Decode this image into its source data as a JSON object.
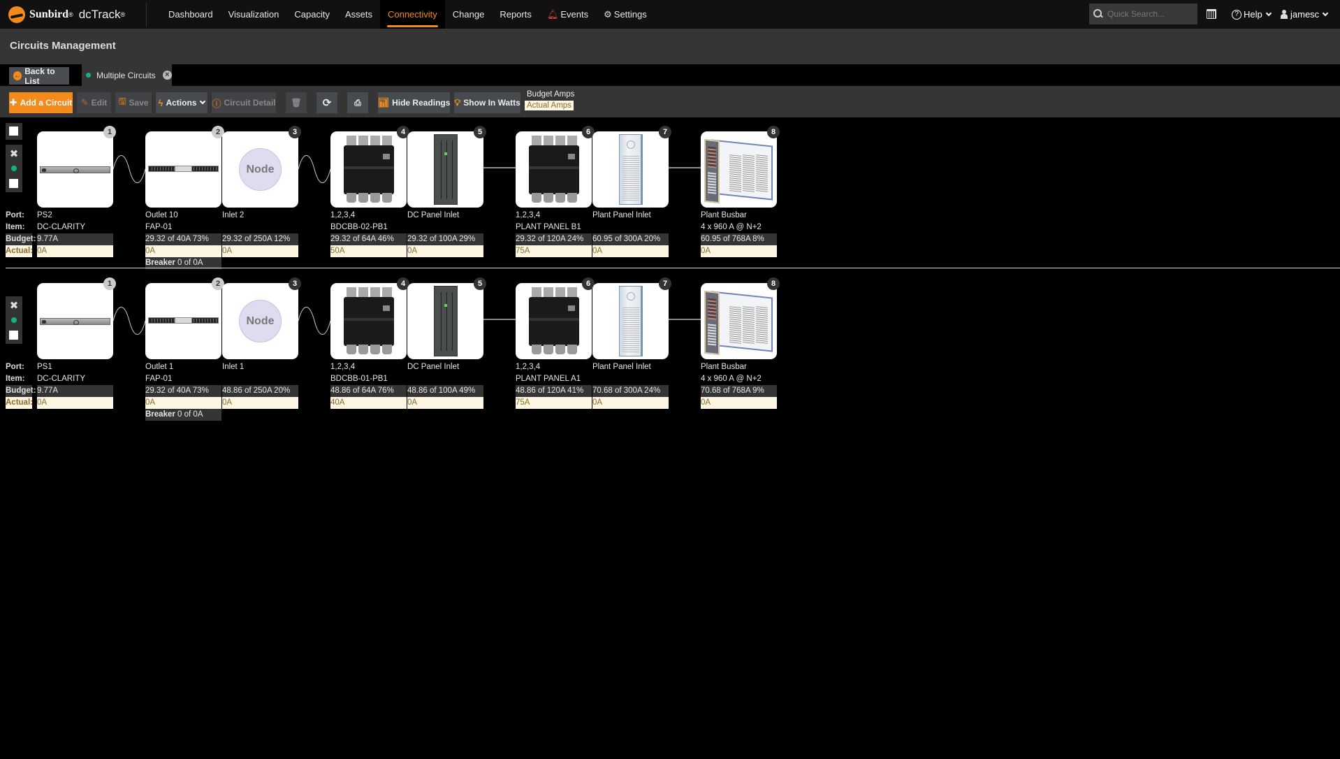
{
  "app": {
    "brand": "Sunbird",
    "product": "dcTrack",
    "registered_mark": "®"
  },
  "nav": {
    "items": [
      {
        "label": "Dashboard",
        "active": false
      },
      {
        "label": "Visualization",
        "active": false
      },
      {
        "label": "Capacity",
        "active": false
      },
      {
        "label": "Assets",
        "active": false
      },
      {
        "label": "Connectivity",
        "active": true
      },
      {
        "label": "Change",
        "active": false
      },
      {
        "label": "Reports",
        "active": false
      },
      {
        "label": "Events",
        "active": false,
        "icon": "bell-icon"
      },
      {
        "label": "Settings",
        "active": false,
        "icon": "gear-icon"
      }
    ],
    "search_placeholder": "Quick Search...",
    "help_label": "Help",
    "user_label": "jamesc"
  },
  "page": {
    "title": "Circuits Management"
  },
  "tabs": {
    "back_label": "Back to List",
    "active_tab_label": "Multiple Circuits"
  },
  "toolbar": {
    "add_circuit": "Add a Circuit",
    "edit": "Edit",
    "save": "Save",
    "actions": "Actions",
    "circuit_detail": "Circuit Detail",
    "hide_readings": "Hide Readings",
    "show_in_watts": "Show In Watts",
    "legend_budget": "Budget Amps",
    "legend_actual": "Actual Amps"
  },
  "row_labels": {
    "port": "Port:",
    "item": "Item:",
    "budget": "Budget:",
    "actual": "Actual:"
  },
  "colors": {
    "accent": "#f28b1c",
    "status_green": "#16b088",
    "actual_bg": "#fdf6e3",
    "actual_text": "#8a6a2a",
    "budget_bg": "#353535"
  },
  "circuits": [
    {
      "has_select_all": true,
      "nodes": [
        {
          "num": "1",
          "type": "server",
          "port": "PS2",
          "item": "DC-CLARITY",
          "budget": "9.77A",
          "actual": "0A"
        },
        {
          "num": "2",
          "type": "pdu",
          "port": "Outlet 10",
          "item": "FAP-01",
          "budget": "29.32 of 40A  73%",
          "actual": "0A",
          "breaker_label": "Breaker",
          "breaker_value": "0 of 0A"
        },
        {
          "num": "3",
          "type": "node",
          "port": "Inlet 2",
          "item": "",
          "budget": "29.32 of 250A  12%",
          "actual": "0A",
          "node_text": "Node"
        },
        {
          "num": "4",
          "type": "breaker",
          "port": "1,2,3,4",
          "item": "BDCBB-02-PB1",
          "budget": "29.32 of 64A  46%",
          "actual": "50A"
        },
        {
          "num": "5",
          "type": "panel",
          "port": "DC Panel Inlet",
          "item": "",
          "budget": "29.32 of 100A  29%",
          "actual": "0A"
        },
        {
          "num": "6",
          "type": "breaker",
          "port": "1,2,3,4",
          "item": "PLANT PANEL B1",
          "budget": "29.32 of 120A  24%",
          "actual": "75A"
        },
        {
          "num": "7",
          "type": "cabinet",
          "port": "Plant Panel Inlet",
          "item": "",
          "budget": "60.95 of 300A  20%",
          "actual": "0A"
        },
        {
          "num": "8",
          "type": "plant",
          "port": "Plant Busbar",
          "item": "4 x 960 A @ N+2",
          "budget": "60.95 of 768A  8%",
          "actual": "0A"
        }
      ]
    },
    {
      "has_select_all": false,
      "nodes": [
        {
          "num": "1",
          "type": "server",
          "port": "PS1",
          "item": "DC-CLARITY",
          "budget": "9.77A",
          "actual": "0A"
        },
        {
          "num": "2",
          "type": "pdu",
          "port": "Outlet 1",
          "item": "FAP-01",
          "budget": "29.32 of 40A  73%",
          "actual": "0A",
          "breaker_label": "Breaker",
          "breaker_value": "0 of 0A"
        },
        {
          "num": "3",
          "type": "node",
          "port": "Inlet 1",
          "item": "",
          "budget": "48.86 of 250A  20%",
          "actual": "0A",
          "node_text": "Node"
        },
        {
          "num": "4",
          "type": "breaker",
          "port": "1,2,3,4",
          "item": "BDCBB-01-PB1",
          "budget": "48.86 of 64A  76%",
          "actual": "40A"
        },
        {
          "num": "5",
          "type": "panel",
          "port": "DC Panel Inlet",
          "item": "",
          "budget": "48.86 of 100A  49%",
          "actual": "0A"
        },
        {
          "num": "6",
          "type": "breaker",
          "port": "1,2,3,4",
          "item": "PLANT PANEL A1",
          "budget": "48.86 of 120A  41%",
          "actual": "75A"
        },
        {
          "num": "7",
          "type": "cabinet",
          "port": "Plant Panel Inlet",
          "item": "",
          "budget": "70.68 of 300A  24%",
          "actual": "0A"
        },
        {
          "num": "8",
          "type": "plant",
          "port": "Plant Busbar",
          "item": "4 x 960 A @ N+2",
          "budget": "70.68 of 768A  9%",
          "actual": "0A"
        }
      ]
    }
  ]
}
